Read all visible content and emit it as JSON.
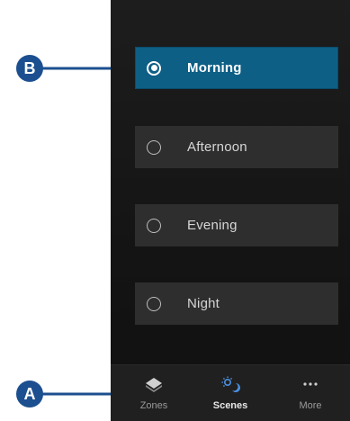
{
  "callouts": {
    "a": "A",
    "b": "B"
  },
  "scenes": {
    "items": [
      {
        "label": "Morning",
        "selected": true
      },
      {
        "label": "Afternoon",
        "selected": false
      },
      {
        "label": "Evening",
        "selected": false
      },
      {
        "label": "Night",
        "selected": false
      }
    ]
  },
  "tabbar": {
    "tabs": [
      {
        "label": "Zones",
        "icon": "zones-icon",
        "active": false
      },
      {
        "label": "Scenes",
        "icon": "scenes-icon",
        "active": true
      },
      {
        "label": "More",
        "icon": "more-icon",
        "active": false
      }
    ]
  },
  "colors": {
    "accent": "#0d5f86",
    "callout": "#1c4f8f",
    "scenes_icon": "#4a90e2"
  }
}
